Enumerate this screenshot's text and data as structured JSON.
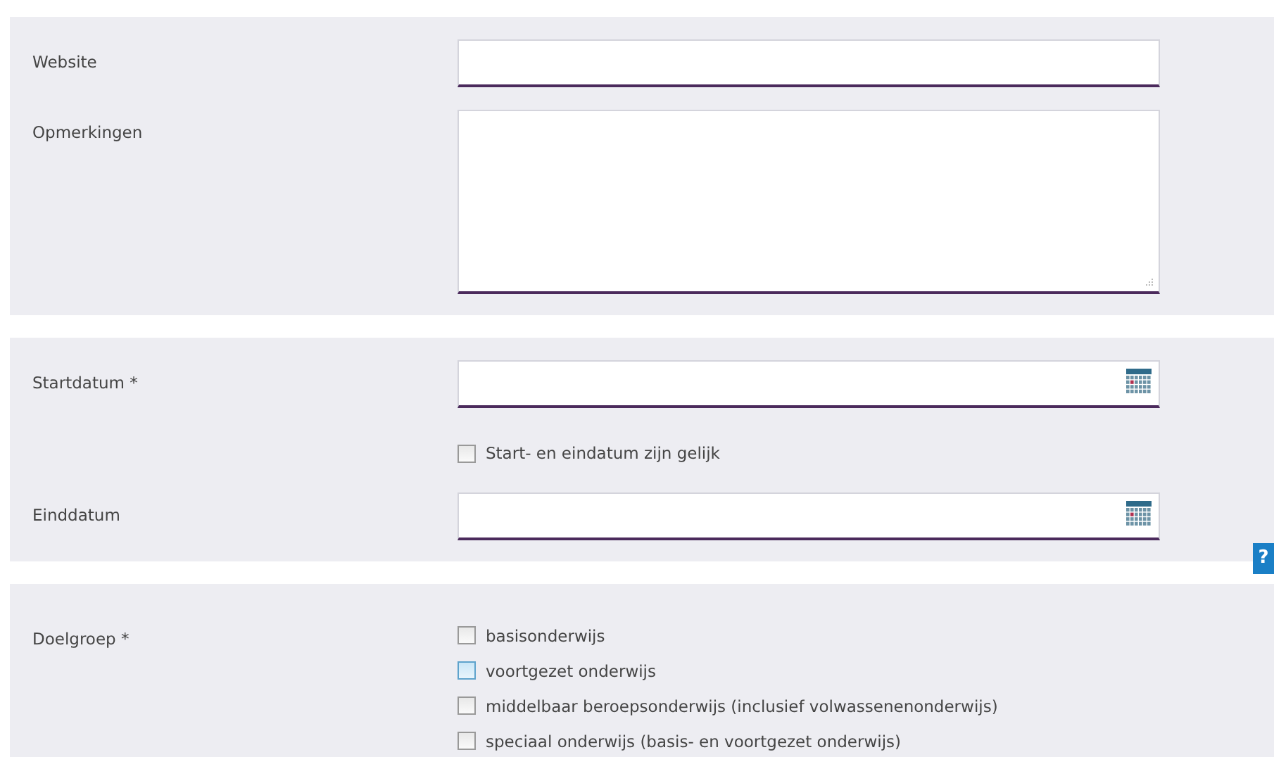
{
  "sections": [
    {
      "rows": [
        {
          "kind": "text",
          "label": "Website"
        },
        {
          "kind": "textarea",
          "label": "Opmerkingen"
        }
      ]
    },
    {
      "rows": [
        {
          "kind": "date",
          "label": "Startdatum *"
        },
        {
          "kind": "checkbox",
          "label": "Start- en eindatum zijn gelijk",
          "checked": false,
          "hovered": false
        },
        {
          "kind": "date",
          "label": "Einddatum"
        }
      ],
      "help": "?"
    },
    {
      "rows": [
        {
          "kind": "checkgroup",
          "label": "Doelgroep *",
          "options": [
            {
              "label": "basisonderwijs",
              "checked": false,
              "hovered": false
            },
            {
              "label": "voortgezet onderwijs",
              "checked": false,
              "hovered": true
            },
            {
              "label": "middelbaar beroepsonderwijs (inclusief volwassenenonderwijs)",
              "checked": false,
              "hovered": false
            },
            {
              "label": "speciaal onderwijs (basis- en voortgezet onderwijs)",
              "checked": false,
              "hovered": false
            }
          ]
        }
      ]
    }
  ]
}
